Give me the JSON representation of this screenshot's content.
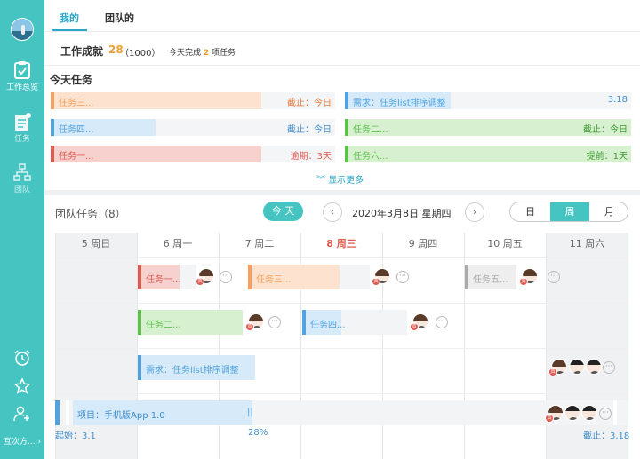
{
  "sidebar": {
    "nav": [
      {
        "label": "工作总览",
        "icon": "clipboard-check-icon"
      },
      {
        "label": "任务",
        "icon": "task-doc-icon"
      },
      {
        "label": "团队",
        "icon": "org-chart-icon"
      }
    ],
    "bottom_label": "互次方...",
    "bottom_icons": [
      "alarm-clock-icon",
      "star-icon",
      "add-user-icon"
    ]
  },
  "tabs": [
    "我的",
    "团队的"
  ],
  "achievement": {
    "label": "工作成就",
    "score": "28",
    "total": "（1000）",
    "today_prefix": "今天完成",
    "today_count": "2",
    "today_suffix": "项任务"
  },
  "today": {
    "title": "今天任务",
    "left": [
      {
        "name": "任务三...",
        "due": "截止：今日",
        "progress": 0.74,
        "color": "#f7a05d",
        "fill": "#fde3cf",
        "due_color": "#e5793d"
      },
      {
        "name": "任务四...",
        "due": "截止：今日",
        "progress": 0.37,
        "color": "#4fa3e0",
        "fill": "#d7eaf9",
        "due_color": "#3f8fd0"
      },
      {
        "name": "任务一...",
        "due": "逾期：3天",
        "progress": 0.74,
        "color": "#e05a4f",
        "fill": "#f6d1cd",
        "due_color": "#e05a4f"
      }
    ],
    "right": [
      {
        "name": "需求：任务list排序调整",
        "due": "3.18",
        "progress": 0.37,
        "color": "#4fa3e0",
        "fill": "#d7eaf9",
        "due_color": "#3f8fd0"
      },
      {
        "name": "任务二...",
        "due": "截止：今日",
        "progress": 1.0,
        "color": "#5cc14a",
        "fill": "#d6f0d0",
        "due_color": "#3c9a2e"
      },
      {
        "name": "任务六...",
        "due": "提前：1天",
        "progress": 1.0,
        "color": "#5cc14a",
        "fill": "#d6f0d0",
        "due_color": "#3c9a2e"
      }
    ],
    "show_more": "显示更多"
  },
  "team": {
    "title": "团队任务（8）",
    "today_btn": "今 天",
    "date": "2020年3月8日 星期四",
    "views": [
      "日",
      "周",
      "月"
    ],
    "active_view": "周",
    "days": [
      {
        "label": "5 周日",
        "weekend": true,
        "today": false
      },
      {
        "label": "6 周一",
        "weekend": false,
        "today": false
      },
      {
        "label": "7 周二",
        "weekend": false,
        "today": false
      },
      {
        "label": "8 周三",
        "weekend": false,
        "today": true
      },
      {
        "label": "9 周四",
        "weekend": false,
        "today": false
      },
      {
        "label": "10 周五",
        "weekend": false,
        "today": false
      },
      {
        "label": "11 周六",
        "weekend": true,
        "today": false
      }
    ],
    "tasks": [
      {
        "name": "任务一...",
        "color": "#e05a4f",
        "fill": "#f6d1cd"
      },
      {
        "name": "任务三...",
        "color": "#f7a05d",
        "fill": "#fde3cf"
      },
      {
        "name": "任务五...",
        "color": "#aaaaaa",
        "fill": "#eeeeee"
      },
      {
        "name": "任务二...",
        "color": "#5cc14a",
        "fill": "#d6f0d0"
      },
      {
        "name": "任务四...",
        "color": "#4fa3e0",
        "fill": "#d7eaf9"
      },
      {
        "name": "需求：任务list排序调整",
        "color": "#4fa3e0",
        "fill": "#d7eaf9"
      }
    ],
    "project": {
      "name": "项目：手机版App 1.0",
      "start": "起始：3.1",
      "progress_label": "28%",
      "progress": 0.28,
      "end": "截止：3.18",
      "handle": "||"
    },
    "owner_badge": "责",
    "more": "···"
  },
  "colors": {
    "accent": "#45c4c2",
    "tab_active": "#2aa6c8",
    "today_red": "#e05a4f",
    "orange": "#f0a030"
  }
}
